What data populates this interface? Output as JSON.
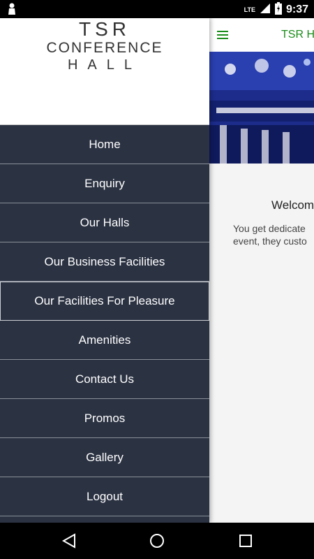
{
  "status": {
    "time": "9:37",
    "network": "LTE"
  },
  "toolbar": {
    "title": "TSR HA"
  },
  "content": {
    "welcome": "Welcom",
    "desc_line1": "You get dedicate",
    "desc_line2": "event, they custo"
  },
  "drawer": {
    "logo": {
      "line1": "TSR",
      "line2": "CONFERENCE",
      "line3": "HALL"
    },
    "items": [
      {
        "label": "Home"
      },
      {
        "label": "Enquiry"
      },
      {
        "label": "Our Halls"
      },
      {
        "label": "Our Business Facilities"
      },
      {
        "label": "Our Facilities For Pleasure"
      },
      {
        "label": "Amenities"
      },
      {
        "label": "Contact Us"
      },
      {
        "label": "Promos"
      },
      {
        "label": "Gallery"
      },
      {
        "label": "Logout"
      }
    ]
  },
  "colors": {
    "drawer_bg": "#2b3242",
    "accent": "#1a8c1a"
  }
}
